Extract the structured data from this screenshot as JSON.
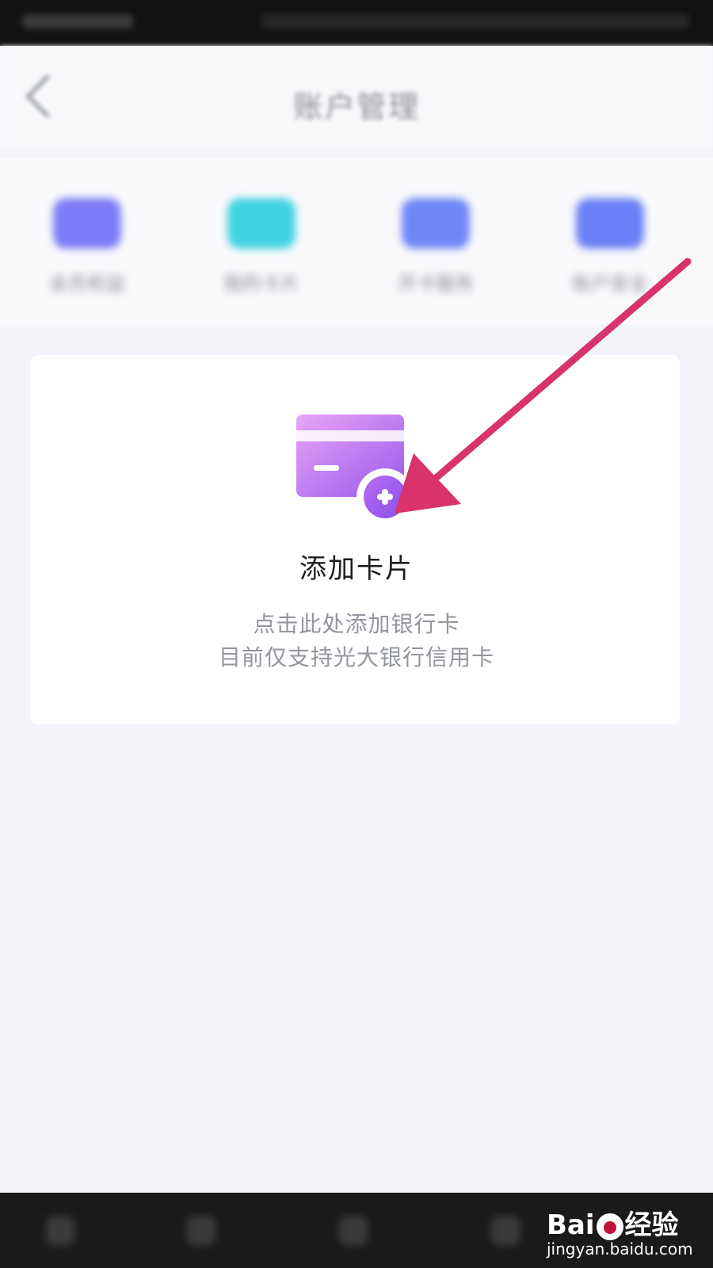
{
  "header": {
    "title": "账户管理"
  },
  "quick_actions": [
    {
      "label": "会员权益",
      "color": "#7b7cf7"
    },
    {
      "label": "我的卡片",
      "color": "#3fd3e2"
    },
    {
      "label": "开卡服务",
      "color": "#6f86f7"
    },
    {
      "label": "账户安全",
      "color": "#6b7ff6"
    }
  ],
  "add_card": {
    "title": "添加卡片",
    "desc_line1": "点击此处添加银行卡",
    "desc_line2": "目前仅支持光大银行信用卡"
  },
  "annotation": {
    "arrow_color": "#d8336d"
  },
  "watermark": {
    "brand": "Bai 经验",
    "brand_left": "Bai",
    "brand_right": "经验",
    "url": "jingyan.baidu.com"
  },
  "colors": {
    "card_gradient_start": "#e6a2f3",
    "card_gradient_end": "#9a57ee",
    "page_bg": "#f2f4f9"
  }
}
